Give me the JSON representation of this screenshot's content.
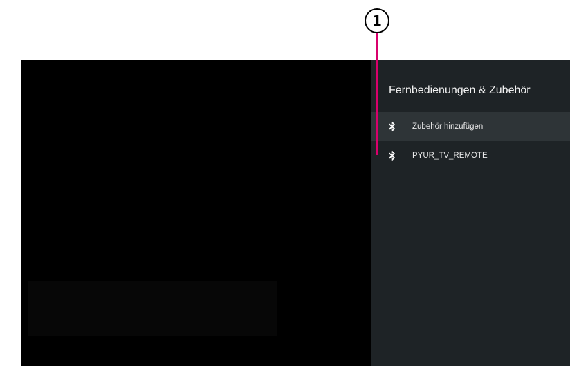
{
  "callout": {
    "number": "1"
  },
  "panel": {
    "title": "Fernbedienungen & Zubehör",
    "items": [
      {
        "label": "Zubehör hinzufügen",
        "icon": "bluetooth-icon",
        "focused": true
      },
      {
        "label": "PYUR_TV_REMOTE",
        "icon": "bluetooth-icon",
        "focused": false
      }
    ]
  },
  "colors": {
    "panel_background": "#1e2326",
    "focused_row": "#2e3437",
    "callout_line": "#d9006c",
    "screen": "#000000"
  }
}
